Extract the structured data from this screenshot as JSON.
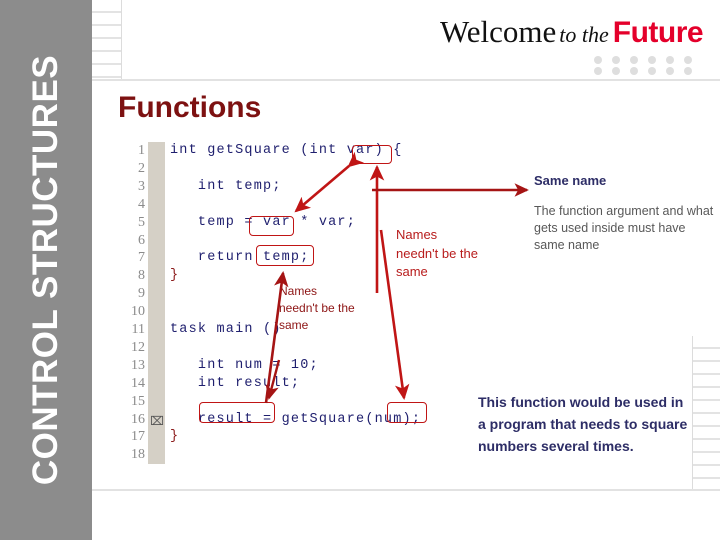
{
  "sidebar": {
    "title": "CONTROL STRUCTURES",
    "bg_color": "#8c8c8c",
    "text_color": "#ffffff"
  },
  "header": {
    "welcome": "Welcome",
    "to_the": "to the",
    "future": "Future",
    "future_color": "#e4002b",
    "dot_color": "#dedede",
    "dot_rows": 2,
    "dots_per_row": 6
  },
  "page_title": {
    "text": "Functions",
    "color": "#7d1111"
  },
  "code_block": {
    "gutter_color": "#d5d0c6",
    "text_color": "#1f1f6e",
    "line_number_color": "#8b8b8b",
    "marker_line": 16,
    "marker_glyph": "⌧",
    "lines": [
      {
        "n": "1",
        "text": "int getSquare (int var) {"
      },
      {
        "n": "2",
        "text": ""
      },
      {
        "n": "3",
        "text": "   int temp;"
      },
      {
        "n": "4",
        "text": ""
      },
      {
        "n": "5",
        "text": "   temp = var * var;"
      },
      {
        "n": "6",
        "text": ""
      },
      {
        "n": "7",
        "text": "   return temp;"
      },
      {
        "n": "8",
        "text": "}"
      },
      {
        "n": "9",
        "text": ""
      },
      {
        "n": "10",
        "text": ""
      },
      {
        "n": "11",
        "text": "task main ()"
      },
      {
        "n": "12",
        "text": ""
      },
      {
        "n": "13",
        "text": "   int num = 10;"
      },
      {
        "n": "14",
        "text": "   int result;"
      },
      {
        "n": "15",
        "text": ""
      },
      {
        "n": "16",
        "text": "   result = getSquare(num);"
      },
      {
        "n": "17",
        "text": "}"
      },
      {
        "n": "18",
        "text": ""
      }
    ]
  },
  "highlights": {
    "color": "#c01515",
    "boxes": [
      {
        "label": "var-parameter-box"
      },
      {
        "label": "var-usage-box"
      },
      {
        "label": "temp-return-box"
      },
      {
        "label": "result-variable-box"
      },
      {
        "label": "num-argument-box"
      }
    ]
  },
  "annotations": {
    "same_name_heading": "Same name",
    "same_name_body": "The function argument and what gets used inside must have same name",
    "names_needn_t_be_the_same_right": "Names needn't be the same",
    "names_needn_t_be_the_same_left": "Names needn't be the same",
    "bottom_note": "This function would be used in a program that needs to square numbers several times.",
    "heading_color": "#2d2d66",
    "body_color": "#585858",
    "red_color": "#b81c1c",
    "arrow_color": "#c01515"
  }
}
